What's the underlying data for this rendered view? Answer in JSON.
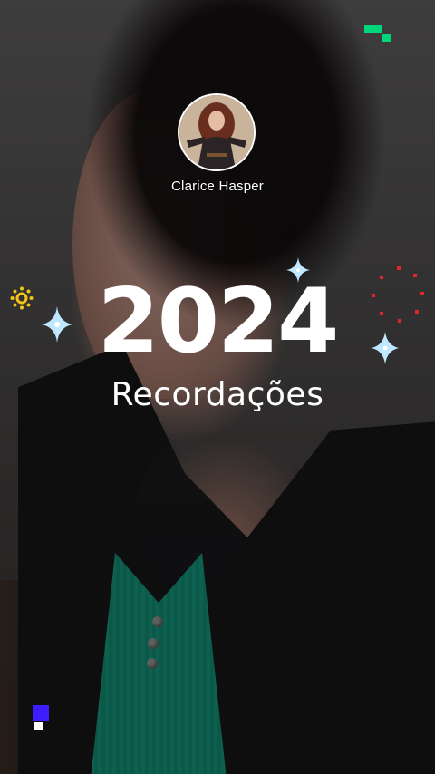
{
  "story": {
    "profile": {
      "username": "Clarice Hasper"
    },
    "title": {
      "year": "2024",
      "subtitle": "Recordações"
    }
  },
  "colors": {
    "text": "#ffffff",
    "sparkle": "#bfe7ff",
    "pixel_green": "#00d67a",
    "pixel_blue": "#3d1cff",
    "firework_red": "#e0262a",
    "sunburst_yellow": "#f2c418",
    "shirt_green": "#138f76"
  },
  "icons": [
    "sparkle-icon",
    "firework-icon",
    "sunburst-icon",
    "pixel-blocks-icon"
  ]
}
